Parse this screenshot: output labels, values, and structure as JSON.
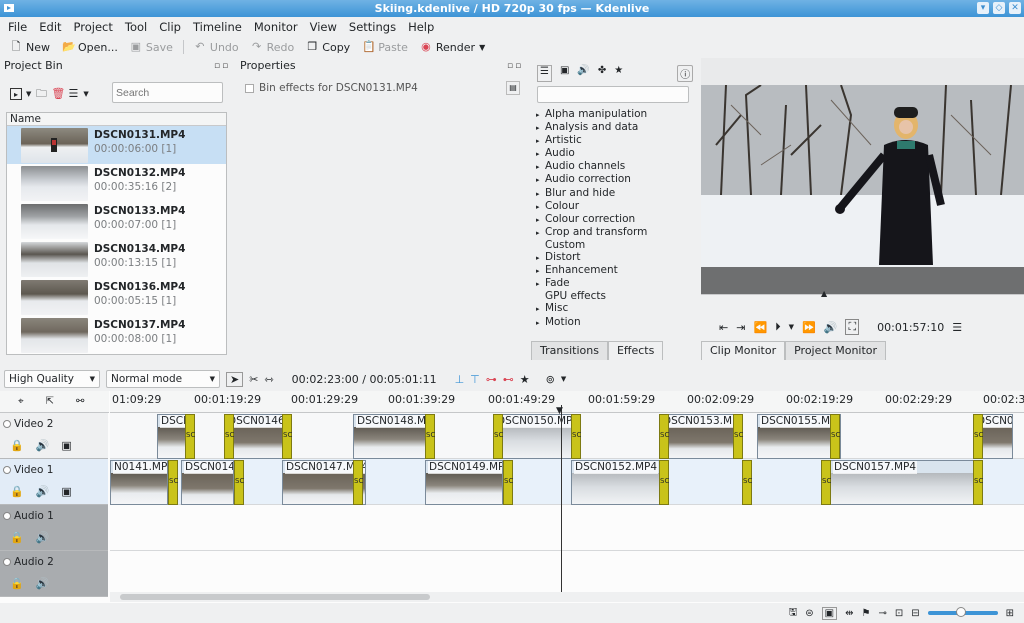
{
  "window": {
    "title": "Skiing.kdenlive / HD 720p 30 fps — Kdenlive"
  },
  "menu": [
    "File",
    "Edit",
    "Project",
    "Tool",
    "Clip",
    "Timeline",
    "Monitor",
    "View",
    "Settings",
    "Help"
  ],
  "toolbar": {
    "new": "New",
    "open": "Open...",
    "save": "Save",
    "undo": "Undo",
    "redo": "Redo",
    "copy": "Copy",
    "paste": "Paste",
    "render": "Render"
  },
  "project_bin": {
    "title": "Project Bin",
    "search_placeholder": "Search",
    "column_name": "Name",
    "clips": [
      {
        "name": "DSCN0131.MP4",
        "duration": "00:00:06:00",
        "count": "[1]"
      },
      {
        "name": "DSCN0132.MP4",
        "duration": "00:00:35:16",
        "count": "[2]"
      },
      {
        "name": "DSCN0133.MP4",
        "duration": "00:00:07:00",
        "count": "[1]"
      },
      {
        "name": "DSCN0134.MP4",
        "duration": "00:00:13:15",
        "count": "[1]"
      },
      {
        "name": "DSCN0136.MP4",
        "duration": "00:00:05:15",
        "count": "[1]"
      },
      {
        "name": "DSCN0137.MP4",
        "duration": "00:00:08:00",
        "count": "[1]"
      }
    ]
  },
  "properties": {
    "title": "Properties",
    "bin_effects": "Bin effects for DSCN0131.MP4"
  },
  "effects": {
    "categories": [
      {
        "label": "Alpha manipulation",
        "expandable": true
      },
      {
        "label": "Analysis and data",
        "expandable": true
      },
      {
        "label": "Artistic",
        "expandable": true
      },
      {
        "label": "Audio",
        "expandable": true
      },
      {
        "label": "Audio channels",
        "expandable": true
      },
      {
        "label": "Audio correction",
        "expandable": true
      },
      {
        "label": "Blur and hide",
        "expandable": true
      },
      {
        "label": "Colour",
        "expandable": true
      },
      {
        "label": "Colour correction",
        "expandable": true
      },
      {
        "label": "Crop and transform",
        "expandable": true
      },
      {
        "label": "Custom",
        "expandable": false
      },
      {
        "label": "Distort",
        "expandable": true
      },
      {
        "label": "Enhancement",
        "expandable": true
      },
      {
        "label": "Fade",
        "expandable": true
      },
      {
        "label": "GPU effects",
        "expandable": false
      },
      {
        "label": "Misc",
        "expandable": true
      },
      {
        "label": "Motion",
        "expandable": true
      }
    ],
    "tab_transitions": "Transitions",
    "tab_effects": "Effects"
  },
  "monitor": {
    "timecode": "00:01:57:10",
    "tab_clip": "Clip Monitor",
    "tab_project": "Project Monitor"
  },
  "timeline_toolbar": {
    "quality": "High Quality",
    "mode": "Normal mode",
    "position": "00:02:23:00 / 00:05:01:11"
  },
  "timeline": {
    "ruler": [
      "01:09:29",
      "00:01:19:29",
      "00:01:29:29",
      "00:01:39:29",
      "00:01:49:29",
      "00:01:59:29",
      "00:02:09:29",
      "00:02:19:29",
      "00:02:29:29",
      "00:02:3"
    ],
    "tracks": [
      "Video 2",
      "Video 1",
      "Audio 1",
      "Audio 2"
    ],
    "video2_clips": [
      "DSCN0",
      "DSCN0146.MP4",
      "DSCN0148.MP4",
      "DSCN0150.MP4",
      "DSCN0153.MP4",
      "DSCN0155.MP4",
      "DSCN01"
    ],
    "video1_clips": [
      "N0141.MP",
      "DSCN014",
      "DSCN0147.MP4",
      "DSCN0149.MP4",
      "DSCN0152.MP4",
      "DSCN0157.MP4"
    ],
    "transition_label": "SC"
  },
  "colors": {
    "accent": "#3d94d6",
    "selection": "#c7dff4",
    "transition": "#c9c31a"
  }
}
